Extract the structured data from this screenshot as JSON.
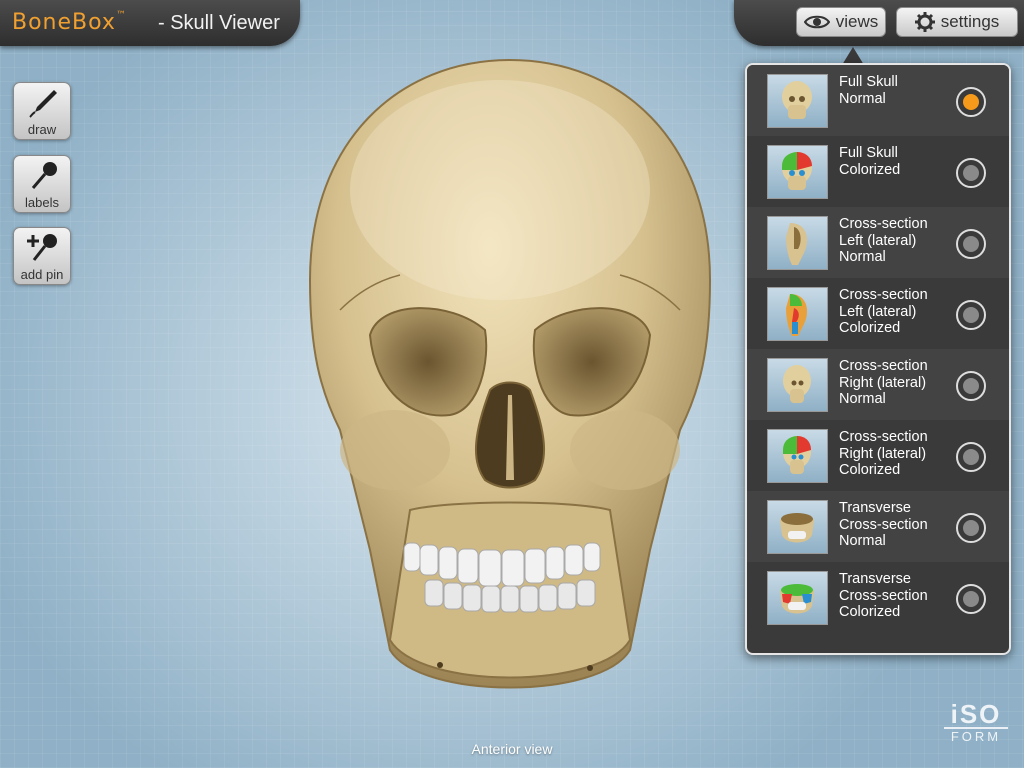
{
  "header": {
    "brand": "BoneBox",
    "trademark": "™",
    "title": "- Skull Viewer",
    "views_label": "views",
    "settings_label": "settings"
  },
  "tools": [
    {
      "label": "draw",
      "icon": "pen-icon"
    },
    {
      "label": "labels",
      "icon": "pin-icon"
    },
    {
      "label": "add pin",
      "icon": "add-pin-icon"
    }
  ],
  "views": [
    {
      "line1": "Full Skull",
      "line2": "Normal",
      "line3": "",
      "selected": true,
      "thumb": "skull-normal"
    },
    {
      "line1": "Full Skull",
      "line2": "Colorized",
      "line3": "",
      "selected": false,
      "thumb": "skull-colorized"
    },
    {
      "line1": "Cross-section",
      "line2": "Left (lateral)",
      "line3": "Normal",
      "selected": false,
      "thumb": "left-normal"
    },
    {
      "line1": "Cross-section",
      "line2": "Left (lateral)",
      "line3": "Colorized",
      "selected": false,
      "thumb": "left-colorized"
    },
    {
      "line1": "Cross-section",
      "line2": "Right (lateral)",
      "line3": "Normal",
      "selected": false,
      "thumb": "right-normal"
    },
    {
      "line1": "Cross-section",
      "line2": "Right (lateral)",
      "line3": "Colorized",
      "selected": false,
      "thumb": "right-colorized"
    },
    {
      "line1": "Transverse",
      "line2": "Cross-section",
      "line3": "Normal",
      "selected": false,
      "thumb": "transverse-normal"
    },
    {
      "line1": "Transverse",
      "line2": "Cross-section",
      "line3": "Colorized",
      "selected": false,
      "thumb": "transverse-colorized"
    }
  ],
  "viewer": {
    "caption": "Anterior view"
  },
  "logo": {
    "top": "iSO",
    "bottom": "FORM"
  },
  "colors": {
    "brand": "#f0a030",
    "selected_radio": "#f59a1b",
    "bone": "#d9c79a",
    "bar": "#3a3a3a"
  }
}
